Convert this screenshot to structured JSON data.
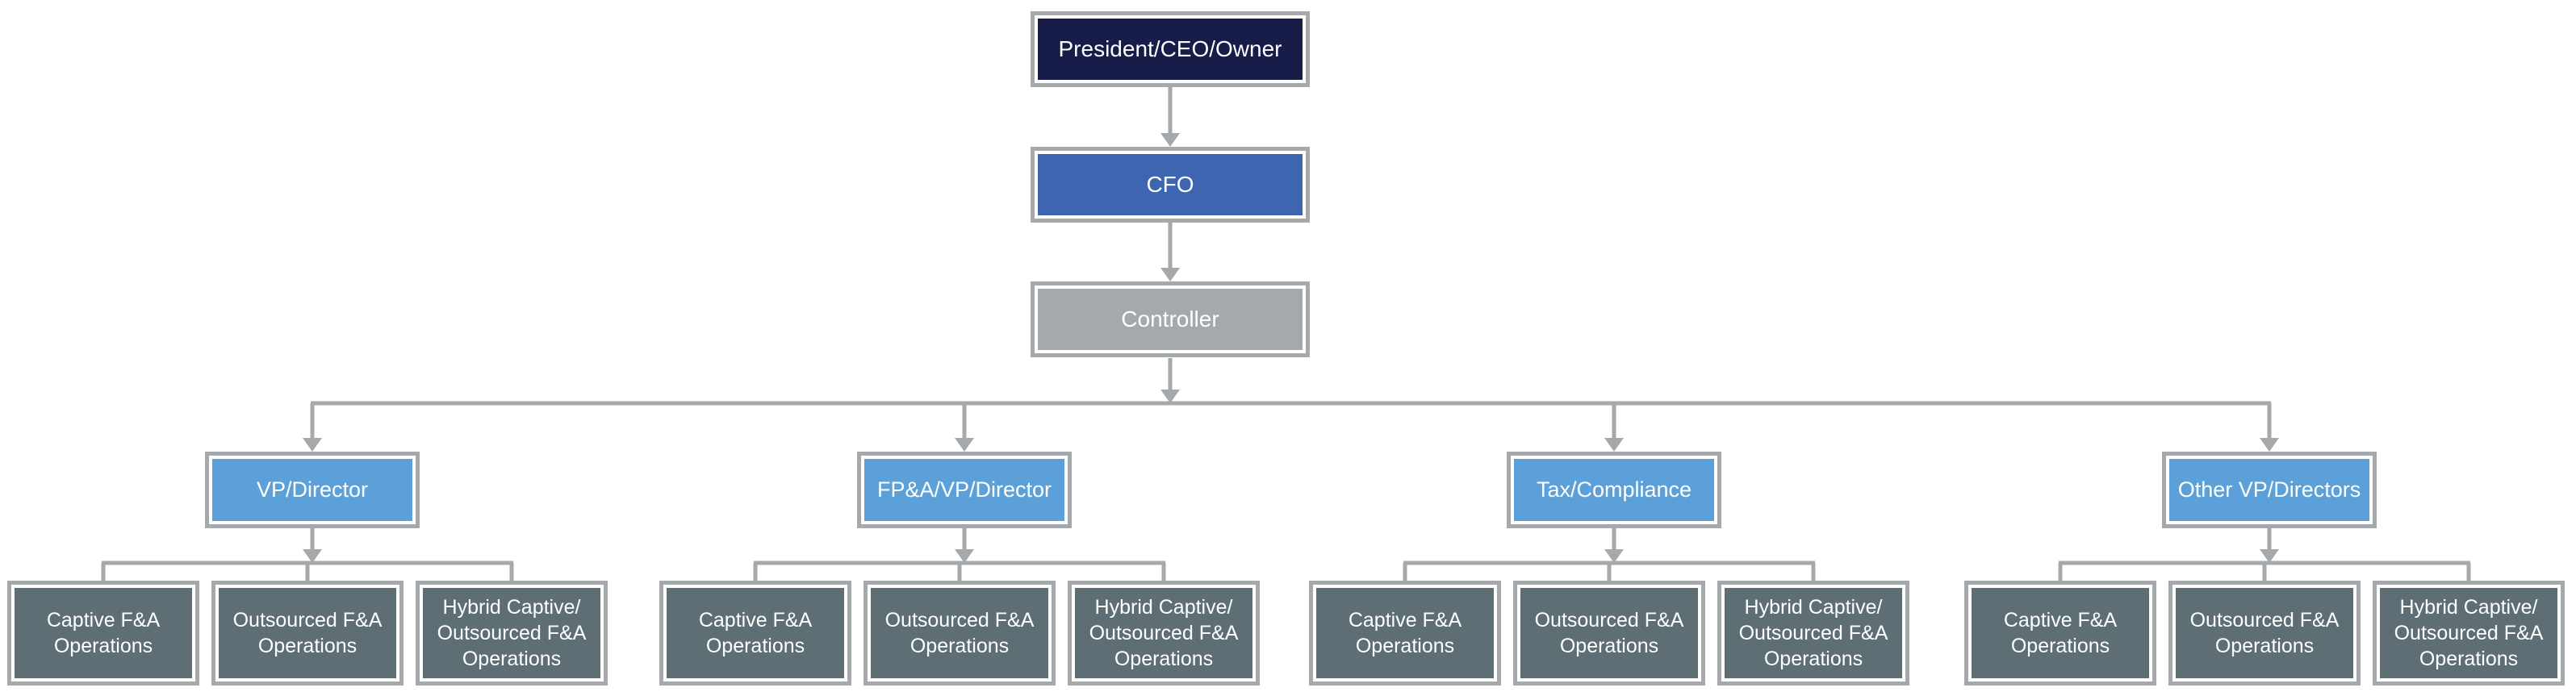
{
  "colors": {
    "ceo": "#171c48",
    "cfo": "#3e66b0",
    "controller": "#a6a9ac",
    "director": "#5ba0d8",
    "operations": "#5d6e74",
    "connector": "#a6a9ac"
  },
  "top": [
    {
      "label": "President/CEO/Owner",
      "color_key": "ceo"
    },
    {
      "label": "CFO",
      "color_key": "cfo"
    },
    {
      "label": "Controller",
      "color_key": "controller"
    }
  ],
  "directors": [
    {
      "label": "VP/Director",
      "children": [
        "Captive F&A Operations",
        "Outsourced F&A Operations",
        "Hybrid Captive/ Outsourced F&A Operations"
      ]
    },
    {
      "label": "FP&A/VP/Director",
      "children": [
        "Captive F&A Operations",
        "Outsourced F&A Operations",
        "Hybrid Captive/ Outsourced F&A Operations"
      ]
    },
    {
      "label": "Tax/Compliance",
      "children": [
        "Captive F&A Operations",
        "Outsourced F&A Operations",
        "Hybrid Captive/ Outsourced F&A Operations"
      ]
    },
    {
      "label": "Other VP/Directors",
      "children": [
        "Captive F&A Operations",
        "Outsourced F&A Operations",
        "Hybrid Captive/ Outsourced F&A Operations"
      ]
    }
  ]
}
